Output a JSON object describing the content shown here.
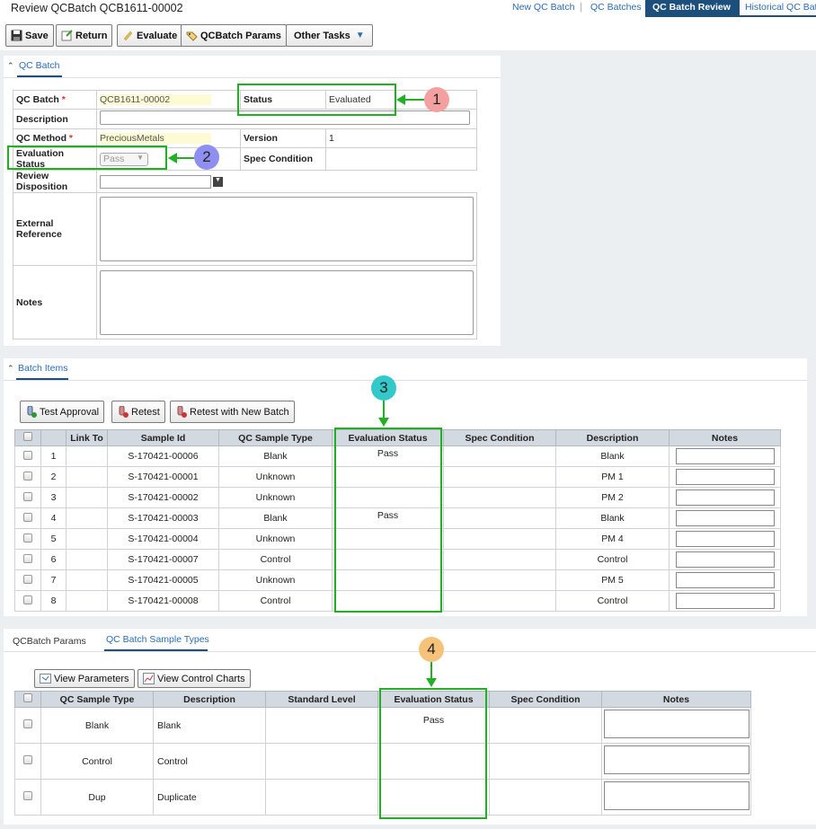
{
  "header": {
    "title": "Review QCBatch QCB1611-00002",
    "nav": [
      "New QC Batch",
      "QC Batches",
      "QC Batch Review",
      "Historical QC Batc"
    ]
  },
  "toolbar": {
    "save": "Save",
    "return": "Return",
    "evaluate": "Evaluate",
    "params": "QCBatch Params",
    "other": "Other Tasks"
  },
  "qc_batch": {
    "tab": "QC Batch",
    "batch_label": "QC Batch",
    "batch_value": "QCB1611-00002",
    "status_label": "Status",
    "status_value": "Evaluated",
    "description_label": "Description",
    "method_label": "QC Method",
    "method_value": "PreciousMetals",
    "version_label": "Version",
    "version_value": "1",
    "eval_label": "Evaluation Status",
    "eval_value": "Pass",
    "spec_label": "Spec Condition",
    "review_label": "Review Disposition",
    "external_label": "External Reference",
    "notes_label": "Notes"
  },
  "batch_items": {
    "tab": "Batch Items",
    "buttons": [
      "Test Approval",
      "Retest",
      "Retest with New Batch"
    ],
    "columns": [
      "",
      "Link To",
      "Sample Id",
      "QC Sample Type",
      "Evaluation Status",
      "Spec Condition",
      "Description",
      "Notes"
    ],
    "rows": [
      {
        "n": "1",
        "id": "S-170421-00006",
        "type": "Blank",
        "eval": "Pass",
        "desc": "Blank"
      },
      {
        "n": "2",
        "id": "S-170421-00001",
        "type": "Unknown",
        "eval": "",
        "desc": "PM 1"
      },
      {
        "n": "3",
        "id": "S-170421-00002",
        "type": "Unknown",
        "eval": "",
        "desc": "PM 2"
      },
      {
        "n": "4",
        "id": "S-170421-00003",
        "type": "Blank",
        "eval": "Pass",
        "desc": "Blank"
      },
      {
        "n": "5",
        "id": "S-170421-00004",
        "type": "Unknown",
        "eval": "",
        "desc": "PM 4"
      },
      {
        "n": "6",
        "id": "S-170421-00007",
        "type": "Control",
        "eval": "",
        "desc": "Control"
      },
      {
        "n": "7",
        "id": "S-170421-00005",
        "type": "Unknown",
        "eval": "",
        "desc": "PM 5"
      },
      {
        "n": "8",
        "id": "S-170421-00008",
        "type": "Control",
        "eval": "",
        "desc": "Control"
      }
    ]
  },
  "sample_types": {
    "tabs": [
      "QCBatch Params",
      "QC Batch Sample Types"
    ],
    "buttons": [
      "View Parameters",
      "View Control Charts"
    ],
    "columns": [
      "",
      "QC Sample Type",
      "Description",
      "Standard Level",
      "Evaluation Status",
      "Spec Condition",
      "Notes"
    ],
    "rows": [
      {
        "type": "Blank",
        "desc": "Blank",
        "eval": "Pass"
      },
      {
        "type": "Control",
        "desc": "Control",
        "eval": ""
      },
      {
        "type": "Dup",
        "desc": "Duplicate",
        "eval": ""
      }
    ]
  },
  "callouts": [
    "1",
    "2",
    "3",
    "4"
  ],
  "colors": {
    "nav_active": "#1d4f7c",
    "callout_green": "#21b021",
    "c1": "#f4a0a0",
    "c2": "#8f8ff2",
    "c3": "#33c9c9",
    "c4": "#f5c27a"
  }
}
